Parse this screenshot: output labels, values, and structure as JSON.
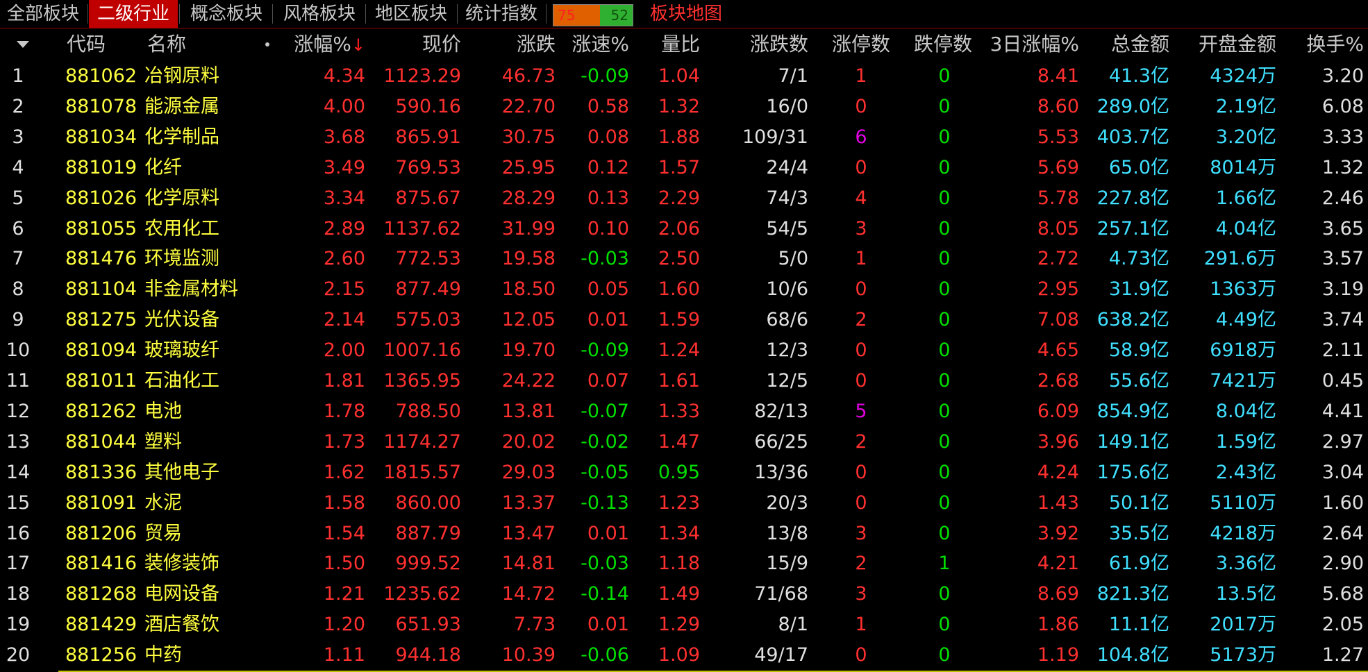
{
  "tabs": [
    {
      "label": "全部板块",
      "active": false
    },
    {
      "label": "二级行业",
      "active": true
    },
    {
      "label": "概念板块",
      "active": false
    },
    {
      "label": "风格板块",
      "active": false
    },
    {
      "label": "地区板块",
      "active": false
    },
    {
      "label": "统计指数",
      "active": false
    }
  ],
  "ratio": {
    "up": "75",
    "down": "52",
    "up_fraction": 0.59
  },
  "map_label": "板块地图",
  "columns": {
    "code": "代码",
    "name": "名称",
    "change_pct": "涨幅%",
    "sort_mark": "↓",
    "price": "现价",
    "change": "涨跌",
    "speed": "涨速%",
    "vol_ratio": "量比",
    "updown": "涨跌数",
    "limit_up": "涨停数",
    "limit_down": "跌停数",
    "three_day": "3日涨幅%",
    "amount": "总金额",
    "open_amount": "开盘金额",
    "turnover": "换手%"
  },
  "colors": {
    "up": "#ff3030",
    "down": "#00e000",
    "code": "#ffff40",
    "money": "#40e0ff",
    "highlight": "#e000e0",
    "active_tab": "#c00000"
  },
  "rows": [
    {
      "n": "1",
      "code": "881062",
      "name": "冶钢原料",
      "pct": "4.34",
      "price": "1123.29",
      "chg": "46.73",
      "speed": "-0.09",
      "vr": "1.04",
      "ud": "7/1",
      "lu": "1",
      "ld": "0",
      "d3": "8.41",
      "amt": "41.3亿",
      "oamt": "4324万",
      "to": "3.20"
    },
    {
      "n": "2",
      "code": "881078",
      "name": "能源金属",
      "pct": "4.00",
      "price": "590.16",
      "chg": "22.70",
      "speed": "0.58",
      "vr": "1.32",
      "ud": "16/0",
      "lu": "0",
      "ld": "0",
      "d3": "8.60",
      "amt": "289.0亿",
      "oamt": "2.19亿",
      "to": "6.08"
    },
    {
      "n": "3",
      "code": "881034",
      "name": "化学制品",
      "pct": "3.68",
      "price": "865.91",
      "chg": "30.75",
      "speed": "0.08",
      "vr": "1.88",
      "ud": "109/31",
      "lu": "6",
      "ld": "0",
      "d3": "5.53",
      "amt": "403.7亿",
      "oamt": "3.20亿",
      "to": "3.33"
    },
    {
      "n": "4",
      "code": "881019",
      "name": "化纤",
      "pct": "3.49",
      "price": "769.53",
      "chg": "25.95",
      "speed": "0.12",
      "vr": "1.57",
      "ud": "24/4",
      "lu": "0",
      "ld": "0",
      "d3": "5.69",
      "amt": "65.0亿",
      "oamt": "8014万",
      "to": "1.32"
    },
    {
      "n": "5",
      "code": "881026",
      "name": "化学原料",
      "pct": "3.34",
      "price": "875.67",
      "chg": "28.29",
      "speed": "0.13",
      "vr": "2.29",
      "ud": "74/3",
      "lu": "4",
      "ld": "0",
      "d3": "5.78",
      "amt": "227.8亿",
      "oamt": "1.66亿",
      "to": "2.46"
    },
    {
      "n": "6",
      "code": "881055",
      "name": "农用化工",
      "pct": "2.89",
      "price": "1137.62",
      "chg": "31.99",
      "speed": "0.10",
      "vr": "2.06",
      "ud": "54/5",
      "lu": "3",
      "ld": "0",
      "d3": "8.05",
      "amt": "257.1亿",
      "oamt": "4.04亿",
      "to": "3.65"
    },
    {
      "n": "7",
      "code": "881476",
      "name": "环境监测",
      "pct": "2.60",
      "price": "772.53",
      "chg": "19.58",
      "speed": "-0.03",
      "vr": "2.50",
      "ud": "5/0",
      "lu": "1",
      "ld": "0",
      "d3": "2.72",
      "amt": "4.73亿",
      "oamt": "291.6万",
      "to": "3.57"
    },
    {
      "n": "8",
      "code": "881104",
      "name": "非金属材料",
      "pct": "2.15",
      "price": "877.49",
      "chg": "18.50",
      "speed": "0.05",
      "vr": "1.60",
      "ud": "10/6",
      "lu": "0",
      "ld": "0",
      "d3": "2.95",
      "amt": "31.9亿",
      "oamt": "1363万",
      "to": "3.19"
    },
    {
      "n": "9",
      "code": "881275",
      "name": "光伏设备",
      "pct": "2.14",
      "price": "575.03",
      "chg": "12.05",
      "speed": "0.01",
      "vr": "1.59",
      "ud": "68/6",
      "lu": "2",
      "ld": "0",
      "d3": "7.08",
      "amt": "638.2亿",
      "oamt": "4.49亿",
      "to": "3.74"
    },
    {
      "n": "10",
      "code": "881094",
      "name": "玻璃玻纤",
      "pct": "2.00",
      "price": "1007.16",
      "chg": "19.70",
      "speed": "-0.09",
      "vr": "1.24",
      "ud": "12/3",
      "lu": "0",
      "ld": "0",
      "d3": "4.65",
      "amt": "58.9亿",
      "oamt": "6918万",
      "to": "2.11"
    },
    {
      "n": "11",
      "code": "881011",
      "name": "石油化工",
      "pct": "1.81",
      "price": "1365.95",
      "chg": "24.22",
      "speed": "0.07",
      "vr": "1.61",
      "ud": "12/5",
      "lu": "0",
      "ld": "0",
      "d3": "2.68",
      "amt": "55.6亿",
      "oamt": "7421万",
      "to": "0.45"
    },
    {
      "n": "12",
      "code": "881262",
      "name": "电池",
      "pct": "1.78",
      "price": "788.50",
      "chg": "13.81",
      "speed": "-0.07",
      "vr": "1.33",
      "ud": "82/13",
      "lu": "5",
      "ld": "0",
      "d3": "6.09",
      "amt": "854.9亿",
      "oamt": "8.04亿",
      "to": "4.41"
    },
    {
      "n": "13",
      "code": "881044",
      "name": "塑料",
      "pct": "1.73",
      "price": "1174.27",
      "chg": "20.02",
      "speed": "-0.02",
      "vr": "1.47",
      "ud": "66/25",
      "lu": "2",
      "ld": "0",
      "d3": "3.96",
      "amt": "149.1亿",
      "oamt": "1.59亿",
      "to": "2.97"
    },
    {
      "n": "14",
      "code": "881336",
      "name": "其他电子",
      "pct": "1.62",
      "price": "1815.57",
      "chg": "29.03",
      "speed": "-0.05",
      "vr": "0.95",
      "ud": "13/36",
      "lu": "0",
      "ld": "0",
      "d3": "4.24",
      "amt": "175.6亿",
      "oamt": "2.43亿",
      "to": "3.04"
    },
    {
      "n": "15",
      "code": "881091",
      "name": "水泥",
      "pct": "1.58",
      "price": "860.00",
      "chg": "13.37",
      "speed": "-0.13",
      "vr": "1.23",
      "ud": "20/3",
      "lu": "0",
      "ld": "0",
      "d3": "1.43",
      "amt": "50.1亿",
      "oamt": "5110万",
      "to": "1.60"
    },
    {
      "n": "16",
      "code": "881206",
      "name": "贸易",
      "pct": "1.54",
      "price": "887.79",
      "chg": "13.47",
      "speed": "0.01",
      "vr": "1.34",
      "ud": "13/8",
      "lu": "3",
      "ld": "0",
      "d3": "3.92",
      "amt": "35.5亿",
      "oamt": "4218万",
      "to": "2.64"
    },
    {
      "n": "17",
      "code": "881416",
      "name": "装修装饰",
      "pct": "1.50",
      "price": "999.52",
      "chg": "14.81",
      "speed": "-0.03",
      "vr": "1.18",
      "ud": "15/9",
      "lu": "2",
      "ld": "1",
      "d3": "4.21",
      "amt": "61.9亿",
      "oamt": "3.36亿",
      "to": "2.90"
    },
    {
      "n": "18",
      "code": "881268",
      "name": "电网设备",
      "pct": "1.21",
      "price": "1235.62",
      "chg": "14.72",
      "speed": "-0.14",
      "vr": "1.49",
      "ud": "71/68",
      "lu": "3",
      "ld": "0",
      "d3": "8.69",
      "amt": "821.3亿",
      "oamt": "13.5亿",
      "to": "5.68"
    },
    {
      "n": "19",
      "code": "881429",
      "name": "酒店餐饮",
      "pct": "1.20",
      "price": "651.93",
      "chg": "7.73",
      "speed": "0.01",
      "vr": "1.29",
      "ud": "8/1",
      "lu": "1",
      "ld": "0",
      "d3": "1.86",
      "amt": "11.1亿",
      "oamt": "2017万",
      "to": "2.05"
    },
    {
      "n": "20",
      "code": "881256",
      "name": "中药",
      "pct": "1.11",
      "price": "944.18",
      "chg": "10.39",
      "speed": "-0.06",
      "vr": "1.09",
      "ud": "49/17",
      "lu": "0",
      "ld": "0",
      "d3": "1.19",
      "amt": "104.8亿",
      "oamt": "5173万",
      "to": "1.27"
    }
  ]
}
